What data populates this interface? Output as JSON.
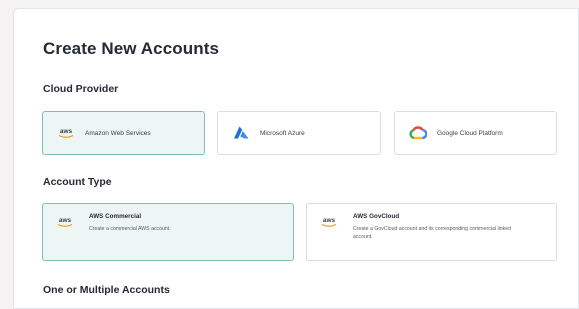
{
  "page": {
    "title": "Create New Accounts"
  },
  "cloud_provider": {
    "label": "Cloud Provider",
    "options": [
      {
        "label": "Amazon Web Services",
        "icon": "aws-logo-icon",
        "selected": true
      },
      {
        "label": "Microsoft Azure",
        "icon": "azure-logo-icon",
        "selected": false
      },
      {
        "label": "Google Cloud Platform",
        "icon": "google-cloud-logo-icon",
        "selected": false
      }
    ]
  },
  "account_type": {
    "label": "Account Type",
    "options": [
      {
        "title": "AWS Commercial",
        "description": "Create a commercial AWS account.",
        "icon": "aws-logo-icon",
        "selected": true
      },
      {
        "title": "AWS GovCloud",
        "description": "Create a GovCloud account and its corresponding commercial linked account.",
        "icon": "aws-logo-icon",
        "selected": false
      }
    ]
  },
  "accounts_count": {
    "label": "One or Multiple Accounts"
  },
  "colors": {
    "selected_bg": "#edf6f4",
    "selected_border": "#7dbfb3",
    "aws_orange": "#f29a1f",
    "azure_blue": "#1a6fd1"
  },
  "logo_text": {
    "aws": "aws"
  }
}
